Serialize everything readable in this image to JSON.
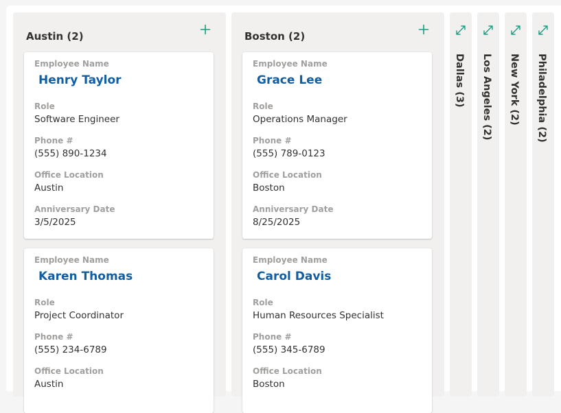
{
  "columns": [
    {
      "title": "Austin (2)",
      "add_icon": "plus-icon",
      "cards": [
        {
          "name_label": "Employee Name",
          "name": "Henry Taylor",
          "role_label": "Role",
          "role": "Software Engineer",
          "phone_label": "Phone #",
          "phone": "(555) 890-1234",
          "office_label": "Office Location",
          "office": "Austin",
          "anniv_label": "Anniversary Date",
          "anniv": "3/5/2025"
        },
        {
          "name_label": "Employee Name",
          "name": "Karen Thomas",
          "role_label": "Role",
          "role": "Project Coordinator",
          "phone_label": "Phone #",
          "phone": "(555) 234-6789",
          "office_label": "Office Location",
          "office": "Austin"
        }
      ]
    },
    {
      "title": "Boston (2)",
      "add_icon": "plus-icon",
      "cards": [
        {
          "name_label": "Employee Name",
          "name": "Grace Lee",
          "role_label": "Role",
          "role": "Operations Manager",
          "phone_label": "Phone #",
          "phone": "(555) 789-0123",
          "office_label": "Office Location",
          "office": "Boston",
          "anniv_label": "Anniversary Date",
          "anniv": "8/25/2025"
        },
        {
          "name_label": "Employee Name",
          "name": "Carol Davis",
          "role_label": "Role",
          "role": "Human Resources Specialist",
          "phone_label": "Phone #",
          "phone": "(555) 345-6789",
          "office_label": "Office Location",
          "office": "Boston"
        }
      ]
    }
  ],
  "collapsed_columns": [
    {
      "title": "Dallas (3)",
      "icon": "expand-icon"
    },
    {
      "title": "Los Angeles (2)",
      "icon": "expand-icon"
    },
    {
      "title": "New York (2)",
      "icon": "expand-icon"
    },
    {
      "title": "Philadelphia (2)",
      "icon": "expand-icon"
    }
  ],
  "colors": {
    "accent": "#1a9c7f",
    "name_link": "#115ea3",
    "column_bg": "#f1f0ef",
    "label": "#a19f9d",
    "text": "#323130"
  }
}
